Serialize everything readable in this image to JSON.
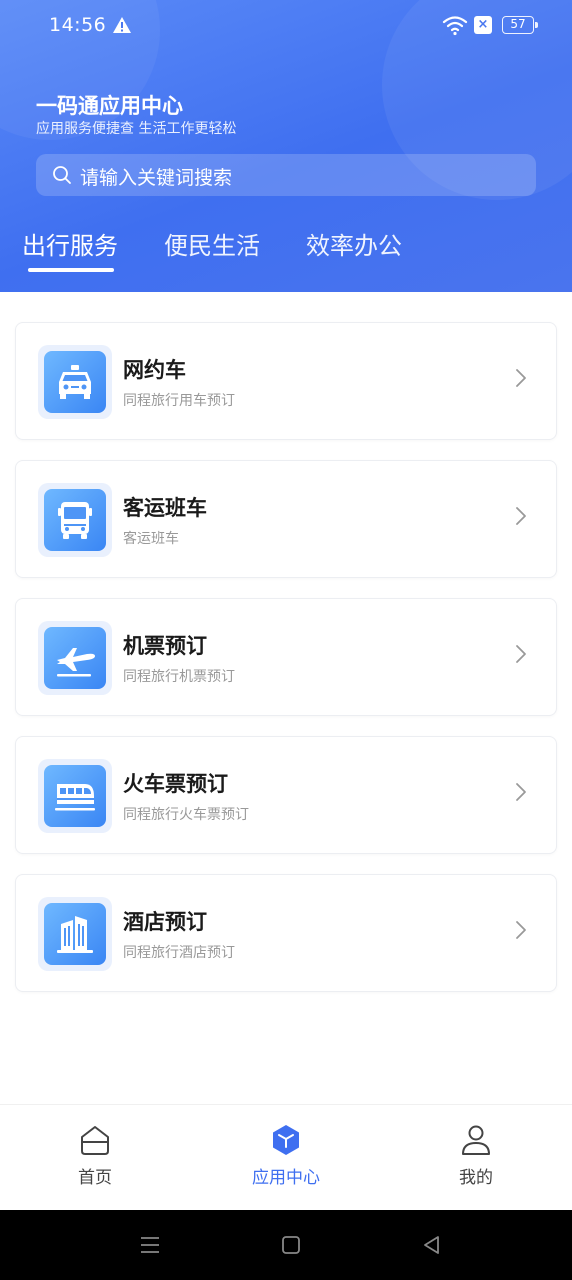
{
  "status": {
    "time": "14:56",
    "battery": "57"
  },
  "header": {
    "title": "一码通应用中心",
    "subtitle": "应用服务便捷查 生活工作更轻松"
  },
  "search": {
    "placeholder": "请输入关键词搜索"
  },
  "tabs": [
    {
      "label": "出行服务",
      "active": true
    },
    {
      "label": "便民生活",
      "active": false
    },
    {
      "label": "效率办公",
      "active": false
    }
  ],
  "services": [
    {
      "title": "网约车",
      "subtitle": "同程旅行用车预订",
      "icon": "taxi-icon"
    },
    {
      "title": "客运班车",
      "subtitle": "客运班车",
      "icon": "bus-icon"
    },
    {
      "title": "机票预订",
      "subtitle": "同程旅行机票预订",
      "icon": "airplane-icon"
    },
    {
      "title": "火车票预订",
      "subtitle": "同程旅行火车票预订",
      "icon": "train-icon"
    },
    {
      "title": "酒店预订",
      "subtitle": "同程旅行酒店预订",
      "icon": "hotel-icon"
    }
  ],
  "bottom_nav": [
    {
      "label": "首页",
      "icon": "home-icon",
      "active": false
    },
    {
      "label": "应用中心",
      "icon": "app-center-icon",
      "active": true
    },
    {
      "label": "我的",
      "icon": "profile-icon",
      "active": false
    }
  ],
  "colors": {
    "primary": "#3f6ff0",
    "icon_gradient_start": "#6fb8ff",
    "icon_gradient_end": "#3a86f4"
  }
}
